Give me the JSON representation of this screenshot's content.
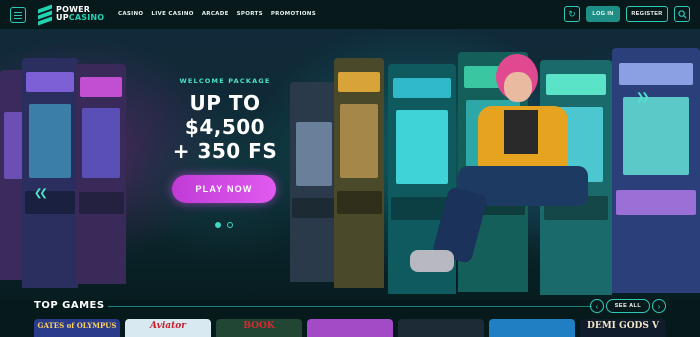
{
  "header": {
    "logo_line1": "POWER",
    "logo_line2a": "UP",
    "logo_line2b": "CASINO",
    "nav": [
      "CASINO",
      "LIVE CASINO",
      "ARCADE",
      "SPORTS",
      "PROMOTIONS"
    ],
    "login_label": "LOG IN",
    "register_label": "REGISTER"
  },
  "hero": {
    "eyebrow": "WELCOME PACKAGE",
    "headline_line1": "UP TO",
    "headline_line2": "$4,500",
    "headline_line3": "+ 350 FS",
    "cta_label": "PLAY NOW",
    "slides_total": 2,
    "slide_active": 1
  },
  "top_games": {
    "title": "TOP GAMES",
    "see_all_label": "SEE ALL",
    "tiles": [
      {
        "label": "GATES of OLYMPUS",
        "bg": "#2a3b8c",
        "fg": "#ffd35a"
      },
      {
        "label": "Aviator",
        "bg": "#d9e9f2",
        "fg": "#c3202b"
      },
      {
        "label": "BOOK",
        "bg": "#214634",
        "fg": "#d8292f"
      },
      {
        "label": "",
        "bg": "#a34ac7",
        "fg": "#ffffff"
      },
      {
        "label": "",
        "bg": "#1c2b36",
        "fg": "#ffffff"
      },
      {
        "label": "",
        "bg": "#1f7fc2",
        "fg": "#ffffff"
      },
      {
        "label": "DEMI GODS V",
        "bg": "#101b2c",
        "fg": "#f3e6c8"
      }
    ]
  },
  "colors": {
    "accent": "#2fc9b8",
    "cta": "#d349e6",
    "background": "#061a1c"
  }
}
